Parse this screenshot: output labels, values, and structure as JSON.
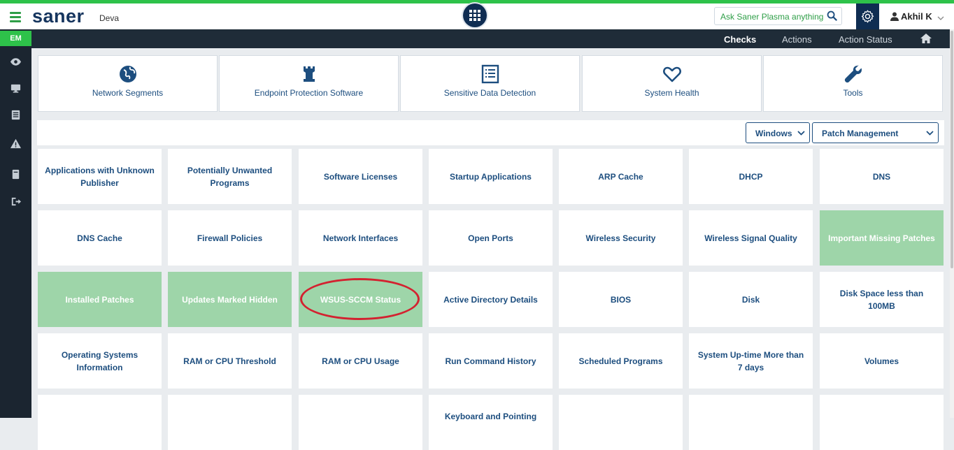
{
  "header": {
    "logo": "saner",
    "org": "Deva",
    "ask_placeholder": "Ask Saner Plasma anything !",
    "user_name": "Akhil K"
  },
  "sidebar": {
    "badge": "EM",
    "icons": [
      "eye-icon",
      "monitor-icon",
      "list-icon",
      "warning-icon",
      "book-icon",
      "logout-icon"
    ]
  },
  "navbar": {
    "items": [
      "Checks",
      "Actions",
      "Action Status"
    ],
    "active": "Checks"
  },
  "categories": [
    {
      "label": "Network Segments",
      "icon": "globe-icon"
    },
    {
      "label": "Endpoint Protection Software",
      "icon": "rook-icon"
    },
    {
      "label": "Sensitive Data Detection",
      "icon": "document-list-icon"
    },
    {
      "label": "System Health",
      "icon": "heart-icon"
    },
    {
      "label": "Tools",
      "icon": "wrench-icon"
    }
  ],
  "filters": {
    "os": "Windows",
    "category": "Patch Management"
  },
  "tiles": [
    "Applications with Unknown Publisher",
    "Potentially Unwanted Programs",
    "Software Licenses",
    "Startup Applications",
    "ARP Cache",
    "DHCP",
    "DNS",
    "DNS Cache",
    "Firewall Policies",
    "Network Interfaces",
    "Open Ports",
    "Wireless Security",
    "Wireless Signal Quality",
    "Important Missing Patches",
    "Installed Patches",
    "Updates Marked Hidden",
    "WSUS-SCCM Status",
    "Active Directory Details",
    "BIOS",
    "Disk",
    "Disk Space less than 100MB",
    "Operating Systems Information",
    "RAM or CPU Threshold",
    "RAM or CPU Usage",
    "Run Command History",
    "Scheduled Programs",
    "System Up-time More than 7 days",
    "Volumes",
    "",
    "",
    "",
    "Keyboard and Pointing",
    "",
    "",
    ""
  ],
  "colors": {
    "accent_green": "#2ec24a",
    "navy": "#0f2d52",
    "tile_text": "#1d4e7f",
    "selected_tile": "#9ed5a9",
    "highlight_circle": "#d32230"
  }
}
